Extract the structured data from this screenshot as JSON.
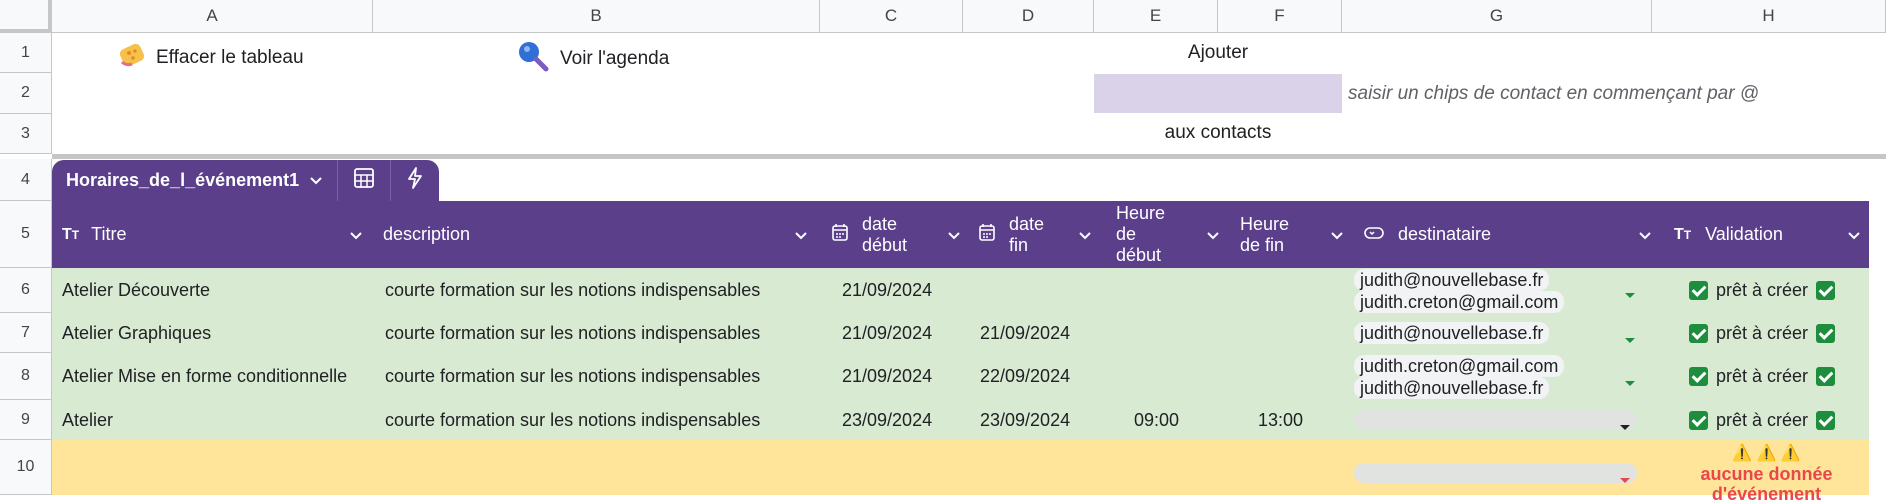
{
  "columns": [
    "A",
    "B",
    "C",
    "D",
    "E",
    "F",
    "G",
    "H"
  ],
  "rows": [
    "1",
    "2",
    "3",
    "4",
    "5",
    "6",
    "7",
    "8",
    "9",
    "10"
  ],
  "top_buttons": {
    "clear_label": "Effacer le tableau",
    "clear_icon": "sponge-icon",
    "agenda_label": "Voir l'agenda",
    "agenda_icon": "magnifier-icon"
  },
  "contacts": {
    "add_label": "Ajouter",
    "hint": "saisir un chips de contact en commençant par @",
    "to_contacts_label": "aux contacts"
  },
  "table": {
    "name": "Horaires_de_l_événement1",
    "headers": {
      "titre": "Titre",
      "description": "description",
      "date_debut_1": "date",
      "date_debut_2": "début",
      "date_fin_1": "date",
      "date_fin_2": "fin",
      "heure_debut_1": "Heure",
      "heure_debut_2": "de",
      "heure_debut_3": "début",
      "heure_fin_1": "Heure",
      "heure_fin_2": "de fin",
      "destinataire": "destinataire",
      "validation": "Validation"
    },
    "rows": [
      {
        "titre": "Atelier Découverte",
        "description": "courte formation sur les notions indispensables",
        "date_debut": "21/09/2024",
        "date_fin": "",
        "heure_debut": "",
        "heure_fin": "",
        "destinataires": [
          "judith@nouvellebase.fr",
          "judith.creton@gmail.com"
        ],
        "validation": "prêt à créer"
      },
      {
        "titre": "Atelier Graphiques",
        "description": "courte formation sur les notions indispensables",
        "date_debut": "21/09/2024",
        "date_fin": "21/09/2024",
        "heure_debut": "",
        "heure_fin": "",
        "destinataires": [
          "judith@nouvellebase.fr"
        ],
        "validation": "prêt à créer"
      },
      {
        "titre": "Atelier Mise en forme conditionnelle",
        "description": "courte formation sur les notions indispensables",
        "date_debut": "21/09/2024",
        "date_fin": "22/09/2024",
        "heure_debut": "",
        "heure_fin": "",
        "destinataires": [
          "judith.creton@gmail.com",
          "judith@nouvellebase.fr"
        ],
        "validation": "prêt à créer"
      },
      {
        "titre": "Atelier",
        "description": "courte formation sur les notions indispensables",
        "date_debut": "23/09/2024",
        "date_fin": "23/09/2024",
        "heure_debut": "09:00",
        "heure_fin": "13:00",
        "destinataires": [],
        "validation": "prêt à créer"
      }
    ],
    "empty_row": {
      "warning_icons": "⚠️ ⚠️ ⚠️",
      "warning_1": "aucune donnée",
      "warning_2": "d'événement"
    }
  },
  "colors": {
    "header": "#5b3f8a",
    "ready_row": "#d9ead3",
    "empty_row": "#ffe599",
    "chip_input": "#d9d2e9",
    "check": "#1e8e3e",
    "warning": "#e8484b"
  }
}
